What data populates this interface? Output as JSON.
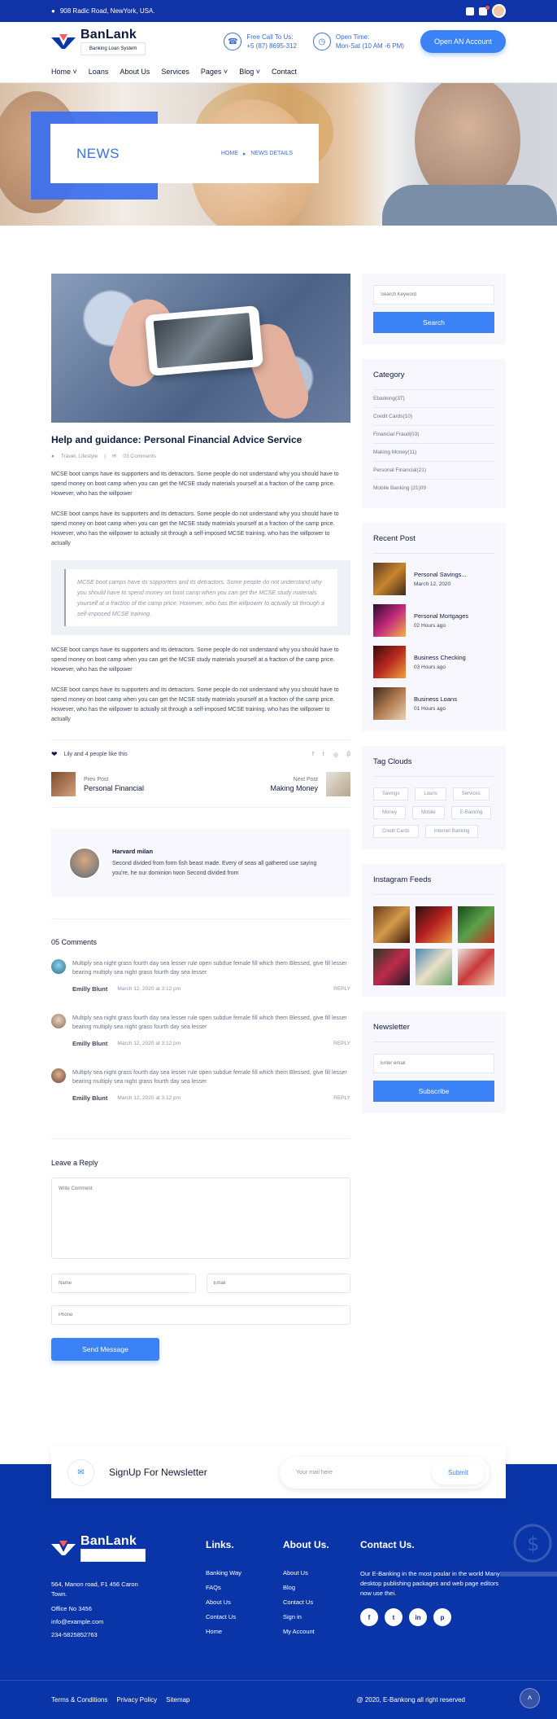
{
  "topbar": {
    "address": "908 Radic Road, NewYork, USA."
  },
  "brand": {
    "name": "BanLank",
    "tagline": "Banking Loan System"
  },
  "header": {
    "call_label": "Free Call To Us:",
    "call_value": "+5 (87) 8695-312",
    "open_label": "Open Time:",
    "open_value": "Mon-Sat (10 AM -6 PM)",
    "cta": "Open AN Account"
  },
  "nav": [
    "Home",
    "Loans",
    "About Us",
    "Services",
    "Pages",
    "Blog",
    "Contact"
  ],
  "hero": {
    "title": "NEWS",
    "crumb_home": "HOME",
    "crumb_current": "NEWS DETAILS"
  },
  "post": {
    "title": "Help and guidance: Personal Financial Advice Service",
    "category": "Travel, Lifestyle",
    "comments": "03 Comments",
    "para1": "MCSE boot camps have its supporters and its detractors. Some people do not understand why you should have to spend money on boot camp when you can get the MCSE study materials yourself at a fraction of the camp price. However, who has the willpower",
    "para2": "MCSE boot camps have its supporters and its detractors. Some people do not understand why you should have to spend money on boot camp when you can get the MCSE study materials yourself at a fraction of the camp price. However, who has the willpower to actually sit through a self-imposed MCSE training. who has the willpower to actually",
    "quote": "MCSE boot camps have its supporters and its detractors. Some people do not understand why you should have to spend money on boot camp when you can get the MCSE study materials yourself at a fraction of the camp price. However, who has the willpower to actually sit through a self-imposed MCSE training.",
    "para3": "MCSE boot camps have its supporters and its detractors. Some people do not understand why you should have to spend money on boot camp when you can get the MCSE study materials yourself at a fraction of the camp price. However, who has the willpower",
    "para4": "MCSE boot camps have its supporters and its detractors. Some people do not understand why you should have to spend money on boot camp when you can get the MCSE study materials yourself at a fraction of the camp price. However, who has the willpower to actually sit through a self-imposed MCSE training. who has the willpower to actually",
    "likes": "Lily and 4 people like this",
    "prev_label": "Prev Post",
    "prev_title": "Personal Financial",
    "next_label": "Next Post",
    "next_title": "Making Money"
  },
  "author": {
    "name": "Harvard milan",
    "bio": "Second divided from form fish beast made. Every of seas all gathered use saying you're, he our dominion twon Second divided from"
  },
  "comments": {
    "heading": "05 Comments",
    "items": [
      {
        "text": "Multiply sea night grass fourth day sea lesser rule open subdue female fill which them Blessed, give fill lesser bearing multiply sea night grass fourth day sea lesser",
        "name": "Emilly Blunt",
        "date": "March 12, 2020 at 3:12 pm",
        "reply": "REPLY"
      },
      {
        "text": "Multiply sea night grass fourth day sea lesser rule open subdue female fill which them Blessed, give fill lesser bearing multiply sea night grass fourth day sea lesser",
        "name": "Emilly Blunt",
        "date": "March 12, 2020 at 3:12 pm",
        "reply": "REPLY"
      },
      {
        "text": "Multiply sea night grass fourth day sea lesser rule open subdue female fill which them Blessed, give fill lesser bearing multiply sea night grass fourth day sea lesser",
        "name": "Emilly Blunt",
        "date": "March 12, 2020 at 3:12 pm",
        "reply": "REPLY"
      }
    ]
  },
  "reply_form": {
    "heading": "Leave a Reply",
    "comment_placeholder": "Write Comment",
    "name_placeholder": "Name",
    "email_placeholder": "Email",
    "phone_placeholder": "Phone",
    "send": "Send Message"
  },
  "sidebar": {
    "search_placeholder": "Search Keyword",
    "search_button": "Search",
    "category_title": "Category",
    "categories": [
      "Ebanking(37)",
      "Credit Cards(10)",
      "Financial Fraud(03)",
      "Making Money(11)",
      "Personal Financial(21)",
      "Mobile Banking (21)09"
    ],
    "recent_title": "Recent Post",
    "recent": [
      {
        "title": "Personal Savings...",
        "date": "March 12, 2020"
      },
      {
        "title": "Personal Mortgages",
        "date": "02 Hours ago"
      },
      {
        "title": "Business Checking",
        "date": "03 Hours ago"
      },
      {
        "title": "Business Loans",
        "date": "01 Hours ago"
      }
    ],
    "tags_title": "Tag Clouds",
    "tags": [
      "Savings",
      "Loans",
      "Services",
      "Money",
      "Mobile",
      "E-Banking",
      "Credit Cards",
      "Internet Banking"
    ],
    "insta_title": "Instagram Feeds",
    "newsletter_title": "Newsletter",
    "newsletter_placeholder": "Enter email",
    "newsletter_button": "Subscribe"
  },
  "signup": {
    "title": "SignUp For Newsletter",
    "placeholder": "Your mail here",
    "button": "Submit"
  },
  "footer": {
    "address": "564, Manon road, F1 456 Caron Town.",
    "office": "Office No 3456",
    "email": "info@example.com",
    "phone": "234-5825852763",
    "links_title": "Links.",
    "links": [
      "Banking Way",
      "FAQs",
      "About Us",
      "Contact Us",
      "Home"
    ],
    "about_title": "About Us.",
    "about_links": [
      "About Us",
      "Blog",
      "Contact Us",
      "Sign in",
      "My Account"
    ],
    "contact_title": "Contact Us.",
    "contact_text": "Our E-Banking in the most poular in the world Many desktop publishing packages and web page editors now use thei.",
    "bottom_links": [
      "Terms & Conditions",
      "Privacy Policy",
      "Sitemap"
    ],
    "copyright": "@ 2020, E-Bankong all right reserved"
  },
  "colors": {
    "primary": "#3b82f6",
    "navy": "#0a35a8",
    "topbar": "#1033a8"
  }
}
